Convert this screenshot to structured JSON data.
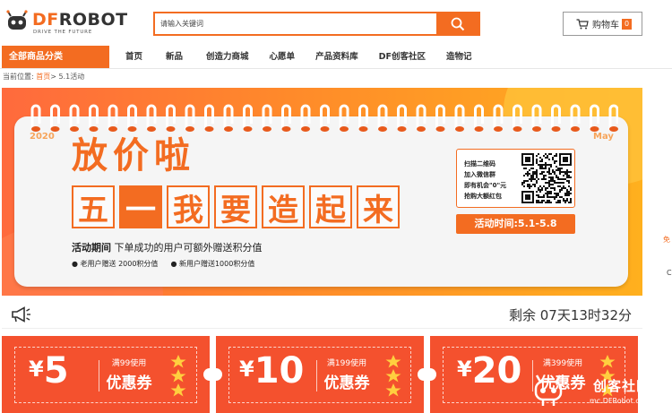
{
  "brand": {
    "name_df": "DF",
    "name_rest": "ROBOT",
    "tagline": "DRIVE THE FUTURE"
  },
  "search": {
    "placeholder": "请输入关键词",
    "button_icon": "search-icon"
  },
  "cart": {
    "label": "购物车",
    "count": "0",
    "icon": "cart-icon"
  },
  "nav": {
    "category_label": "全部商品分类",
    "items": [
      "首页",
      "新品",
      "创造力商城",
      "心愿单",
      "产品资料库",
      "DF创客社区",
      "造物记"
    ]
  },
  "breadcrumb": {
    "prefix": "当前位置:",
    "home": "首页",
    "separator": ">",
    "current": "5.1活动"
  },
  "banner": {
    "year": "2020",
    "month": "May",
    "title_line1": [
      "放",
      "价",
      "啦"
    ],
    "title_line2": [
      "五",
      "一",
      "我",
      "要",
      "造",
      "起",
      "来"
    ],
    "period_label": "活动期间",
    "period_text": "下单成功的用户可额外赠送积分值",
    "bullets": [
      "● 老用户赠送 2000积分值",
      "● 新用户赠送1000积分值"
    ],
    "qr_lines": [
      "扫描二维码",
      "加入微信群",
      "即有机会\"0\"元",
      "抢购大额红包"
    ],
    "dates": "活动时间:5.1-5.8",
    "colors": {
      "accent": "#f36c21",
      "gradient_start": "#ff6a3d",
      "gradient_end": "#ffb01e"
    }
  },
  "side": {
    "tab_char": "免",
    "peek_char": "C"
  },
  "countdown": {
    "icon": "megaphone-icon",
    "text": "剩余 07天13时32分"
  },
  "coupons": [
    {
      "yen": "¥",
      "amount": "5",
      "condition": "满99使用",
      "label": "优惠券"
    },
    {
      "yen": "¥",
      "amount": "10",
      "condition": "满199使用",
      "label": "优惠券"
    },
    {
      "yen": "¥",
      "amount": "20",
      "condition": "满399使用",
      "label": "优惠券"
    }
  ],
  "watermark": {
    "title": "创客社区",
    "url": "mc.DFRobot.com.cn"
  }
}
